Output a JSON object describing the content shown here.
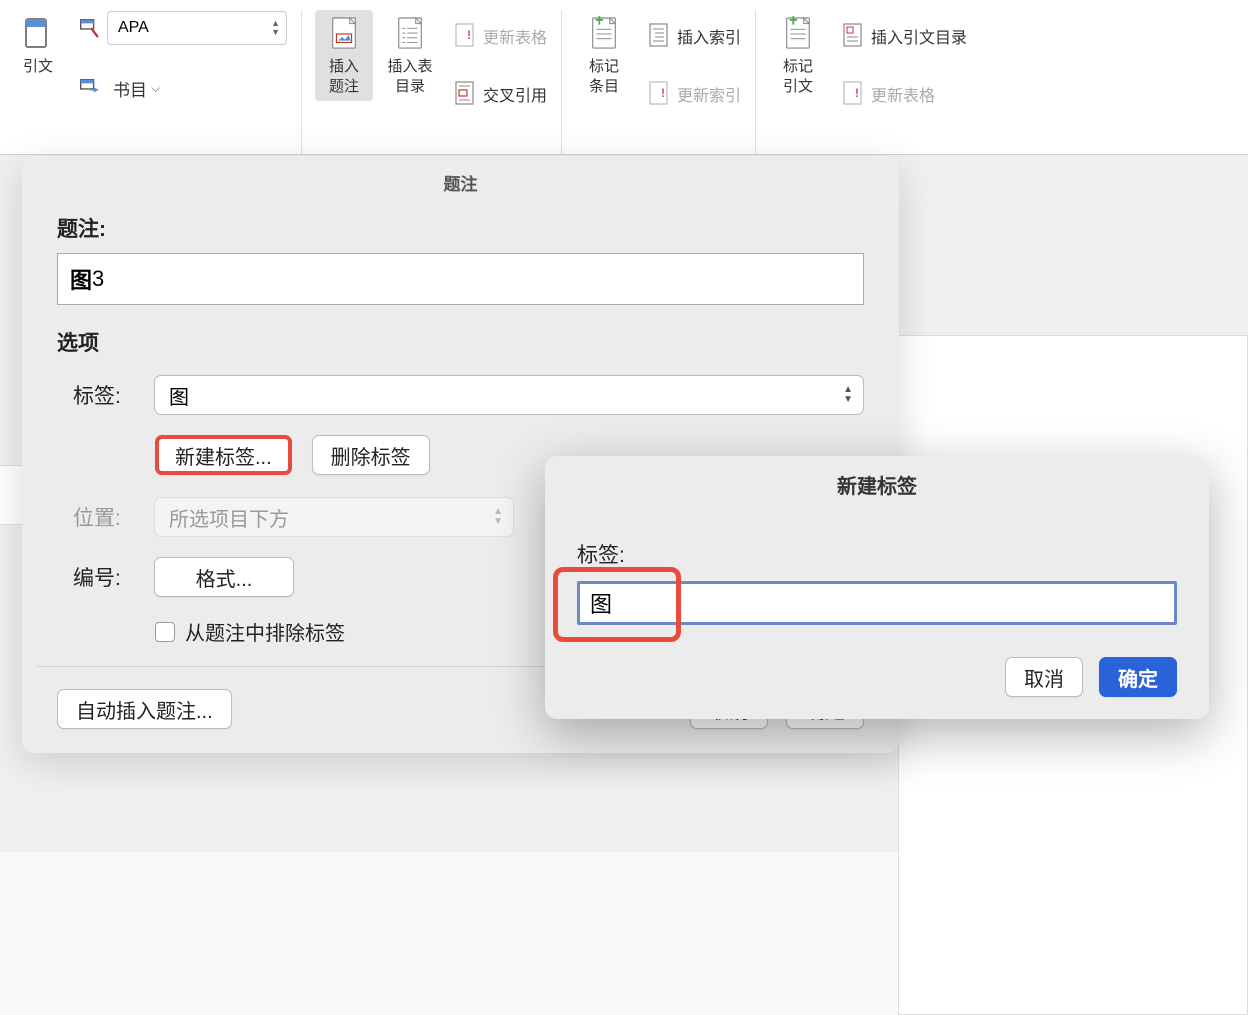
{
  "ribbon": {
    "citation_label": "引文",
    "style_value": "APA",
    "bibliography_label": "书目",
    "insert_caption": "插入\n题注",
    "insert_table_figures": "插入表\n目录",
    "update_table": "更新表格",
    "cross_reference": "交叉引用",
    "mark_entry": "标记\n条目",
    "insert_index": "插入索引",
    "update_index": "更新索引",
    "mark_citation": "标记\n引文",
    "insert_toa": "插入引文目录",
    "update_table2": "更新表格"
  },
  "dialog": {
    "title": "题注",
    "caption_label": "题注:",
    "caption_bold": "图",
    "caption_value": " 3",
    "options_label": "选项",
    "label_label": "标签:",
    "label_value": "图",
    "new_label_btn": "新建标签...",
    "delete_label_btn": "删除标签",
    "position_label": "位置:",
    "position_value": "所选项目下方",
    "number_label": "编号:",
    "number_btn": "格式...",
    "exclude_label": "从题注中排除标签",
    "auto_caption_btn": "自动插入题注...",
    "cancel_btn": "取消",
    "ok_btn": "确定"
  },
  "newlabel": {
    "title": "新建标签",
    "label": "标签:",
    "value": "图",
    "cancel": "取消",
    "ok": "确定"
  }
}
